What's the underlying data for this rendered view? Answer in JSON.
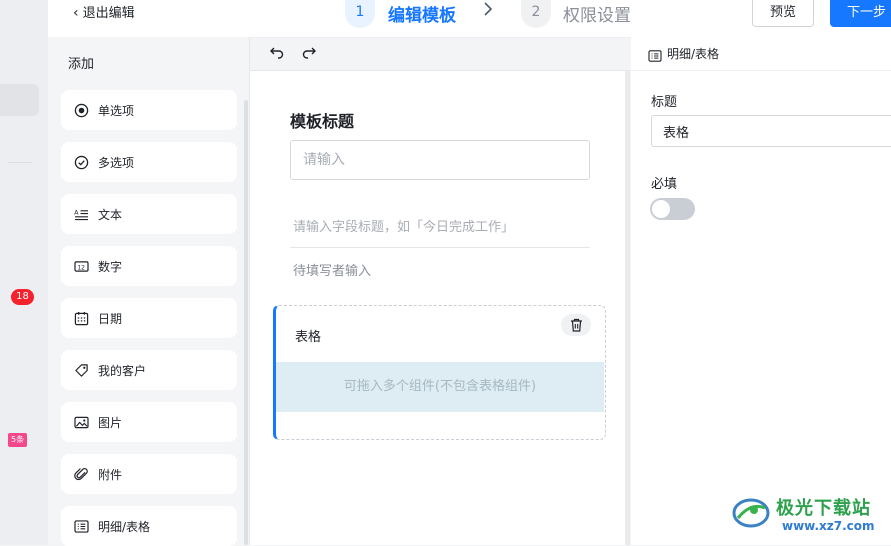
{
  "header": {
    "back_label": "退出编辑",
    "steps": [
      {
        "num": "1",
        "label": "编辑模板"
      },
      {
        "num": "2",
        "label": "权限设置"
      }
    ],
    "preview_label": "预览",
    "next_label": "下一步"
  },
  "left_strip": {
    "badge_count": "18",
    "badge_new": "5条"
  },
  "components": {
    "title": "添加",
    "items": [
      {
        "label": "单选项",
        "icon": "radio-icon"
      },
      {
        "label": "多选项",
        "icon": "check-circle-icon"
      },
      {
        "label": "文本",
        "icon": "text-lines-icon"
      },
      {
        "label": "数字",
        "icon": "number-icon"
      },
      {
        "label": "日期",
        "icon": "calendar-icon"
      },
      {
        "label": "我的客户",
        "icon": "customer-tag-icon"
      },
      {
        "label": "图片",
        "icon": "image-icon"
      },
      {
        "label": "附件",
        "icon": "paperclip-icon"
      },
      {
        "label": "明细/表格",
        "icon": "table-icon"
      }
    ]
  },
  "canvas": {
    "section_title": "模板标题",
    "title_placeholder": "请输入",
    "field_placeholder": "请输入字段标题，如「今日完成工作」",
    "field_hint": "待填写者输入",
    "table_card": {
      "title": "表格",
      "drop_hint": "可拖入多个组件(不包含表格组件)"
    }
  },
  "properties": {
    "header": "明细/表格",
    "title_label": "标题",
    "title_value": "表格",
    "required_label": "必填",
    "required_on": false
  },
  "watermark": {
    "name": "极光下载站",
    "url": "www.xz7.com"
  },
  "colors": {
    "accent": "#1677ff",
    "badge": "#f5222d",
    "drop_zone": "#deedf3"
  }
}
